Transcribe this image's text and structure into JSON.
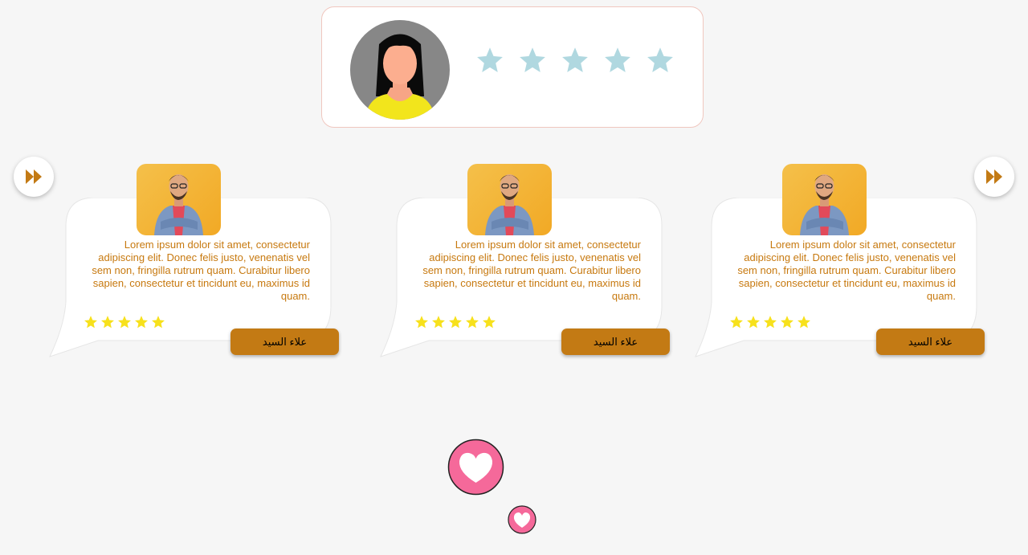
{
  "profile": {
    "rating_max": 5,
    "star_color": "#b0d8e0",
    "avatar_icon": "woman-avatar-icon"
  },
  "navigation": {
    "prev_icon": "fast-forward-icon",
    "next_icon": "fast-forward-icon",
    "accent": "#c37a14"
  },
  "testimonials": [
    {
      "text": "Lorem ipsum dolor sit amet, consectetur adipiscing elit. Donec felis justo, venenatis vel sem non, fringilla rutrum quam. Curabitur libero sapien, consectetur et tincidunt eu, maximus id quam.",
      "rating": 5,
      "name": "علاء السيد"
    },
    {
      "text": "Lorem ipsum dolor sit amet, consectetur adipiscing elit. Donec felis justo, venenatis vel sem non, fringilla rutrum quam. Curabitur libero sapien, consectetur et tincidunt eu, maximus id quam.",
      "rating": 5,
      "name": "علاء السيد"
    },
    {
      "text": "Lorem ipsum dolor sit amet, consectetur adipiscing elit. Donec felis justo, venenatis vel sem non, fringilla rutrum quam. Curabitur libero sapien, consectetur et tincidunt eu, maximus id quam.",
      "rating": 5,
      "name": "علاء السيد"
    }
  ],
  "colors": {
    "text": "#c7790f",
    "button": "#c37a14",
    "small_star": "#f7e11c",
    "heart_bg": "#f5699a"
  }
}
